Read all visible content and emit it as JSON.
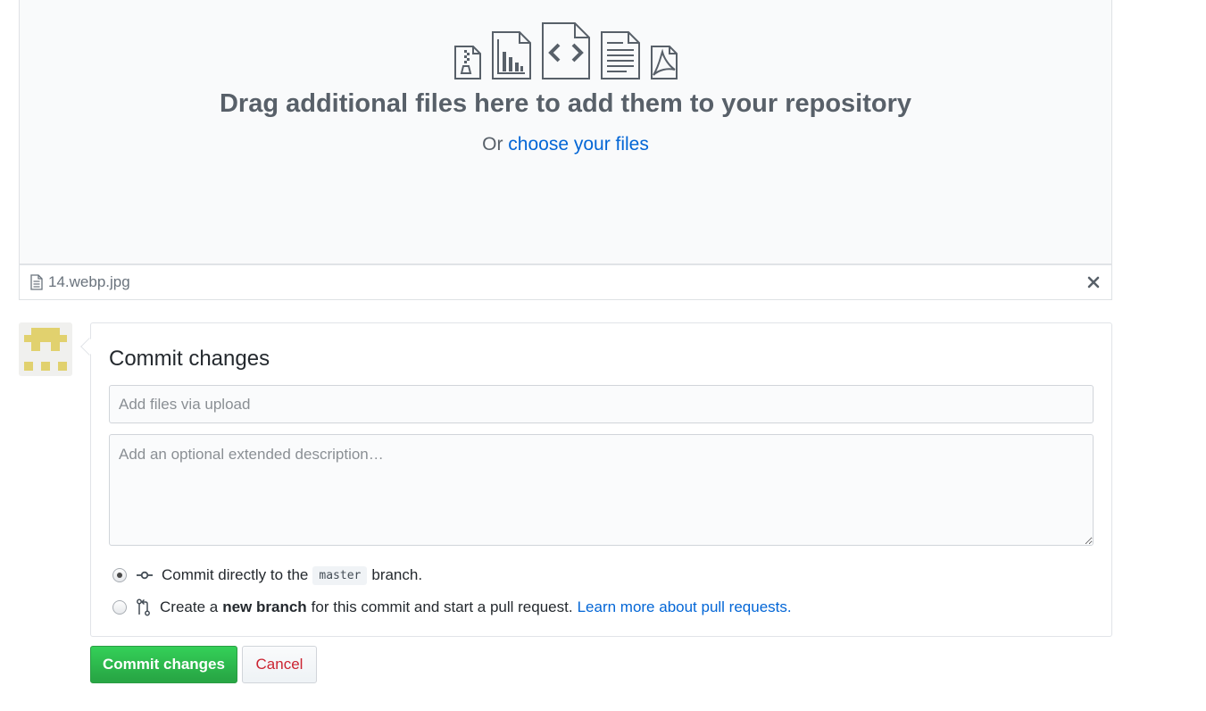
{
  "dropzone": {
    "title": "Drag additional files here to add them to your repository",
    "sub_prefix": "Or",
    "choose_link": "choose your files"
  },
  "file_list": {
    "files": [
      {
        "name": "14.webp.jpg"
      }
    ]
  },
  "commit": {
    "heading": "Commit changes",
    "summary_placeholder": "Add files via upload",
    "summary_value": "",
    "description_placeholder": "Add an optional extended description…",
    "option_direct": {
      "prefix": "Commit directly to the",
      "branch": "master",
      "suffix": "branch.",
      "selected": true
    },
    "option_new_branch": {
      "prefix": "Create a",
      "bold": "new branch",
      "suffix": "for this commit and start a pull request.",
      "link": "Learn more about pull requests.",
      "selected": false
    }
  },
  "buttons": {
    "commit_label": "Commit changes",
    "cancel_label": "Cancel"
  },
  "icons": {
    "dropzone_icons": [
      "file-zip-icon",
      "graph-icon",
      "file-code-icon",
      "file-text-icon",
      "file-pdf-icon"
    ],
    "file_row_icon": "file-icon",
    "remove_icon": "x-icon",
    "direct_commit_icon": "git-commit-icon",
    "new_branch_icon": "git-pull-request-icon"
  },
  "colors": {
    "link": "#0366d6",
    "primary_button": "#28a745",
    "cancel_text": "#cb2431",
    "avatar": "#e1d16e"
  }
}
